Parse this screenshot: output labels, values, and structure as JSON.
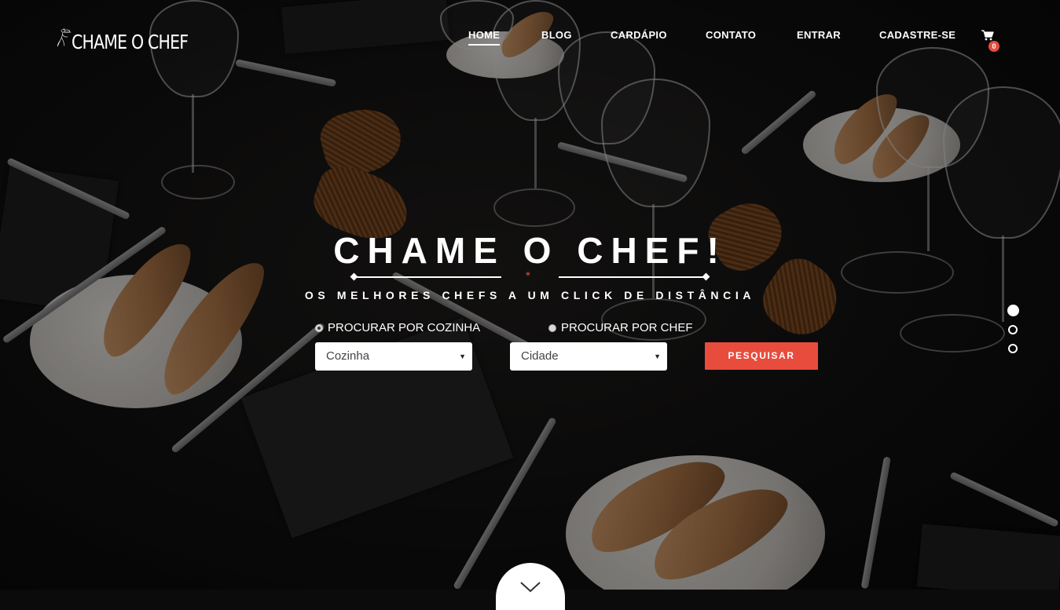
{
  "brand": {
    "name": "CHAME O CHEF"
  },
  "nav": {
    "items": [
      {
        "label": "HOME",
        "active": true
      },
      {
        "label": "BLOG",
        "active": false
      },
      {
        "label": "CARDÁPIO",
        "active": false
      },
      {
        "label": "CONTATO",
        "active": false
      },
      {
        "label": "ENTRAR",
        "active": false
      },
      {
        "label": "CADASTRE-SE",
        "active": false
      }
    ],
    "cart_icon": "shopping-cart-icon",
    "cart_count": "0"
  },
  "hero": {
    "title": "CHAME O CHEF!",
    "divider_mark": "*",
    "subtitle": "OS MELHORES CHEFS A UM CLICK DE DISTÂNCIA"
  },
  "search": {
    "radio_cuisine": {
      "label": "PROCURAR POR COZINHA",
      "checked": true
    },
    "radio_chef": {
      "label": "PROCURAR POR CHEF",
      "checked": false
    },
    "cuisine_select": "Cozinha",
    "city_select": "Cidade",
    "button": "PESQUISAR"
  },
  "slider": {
    "count": 3,
    "active_index": 0
  },
  "scroll_icon": "chevron-down-icon",
  "colors": {
    "accent": "#e84c3d",
    "text": "#ffffff"
  }
}
